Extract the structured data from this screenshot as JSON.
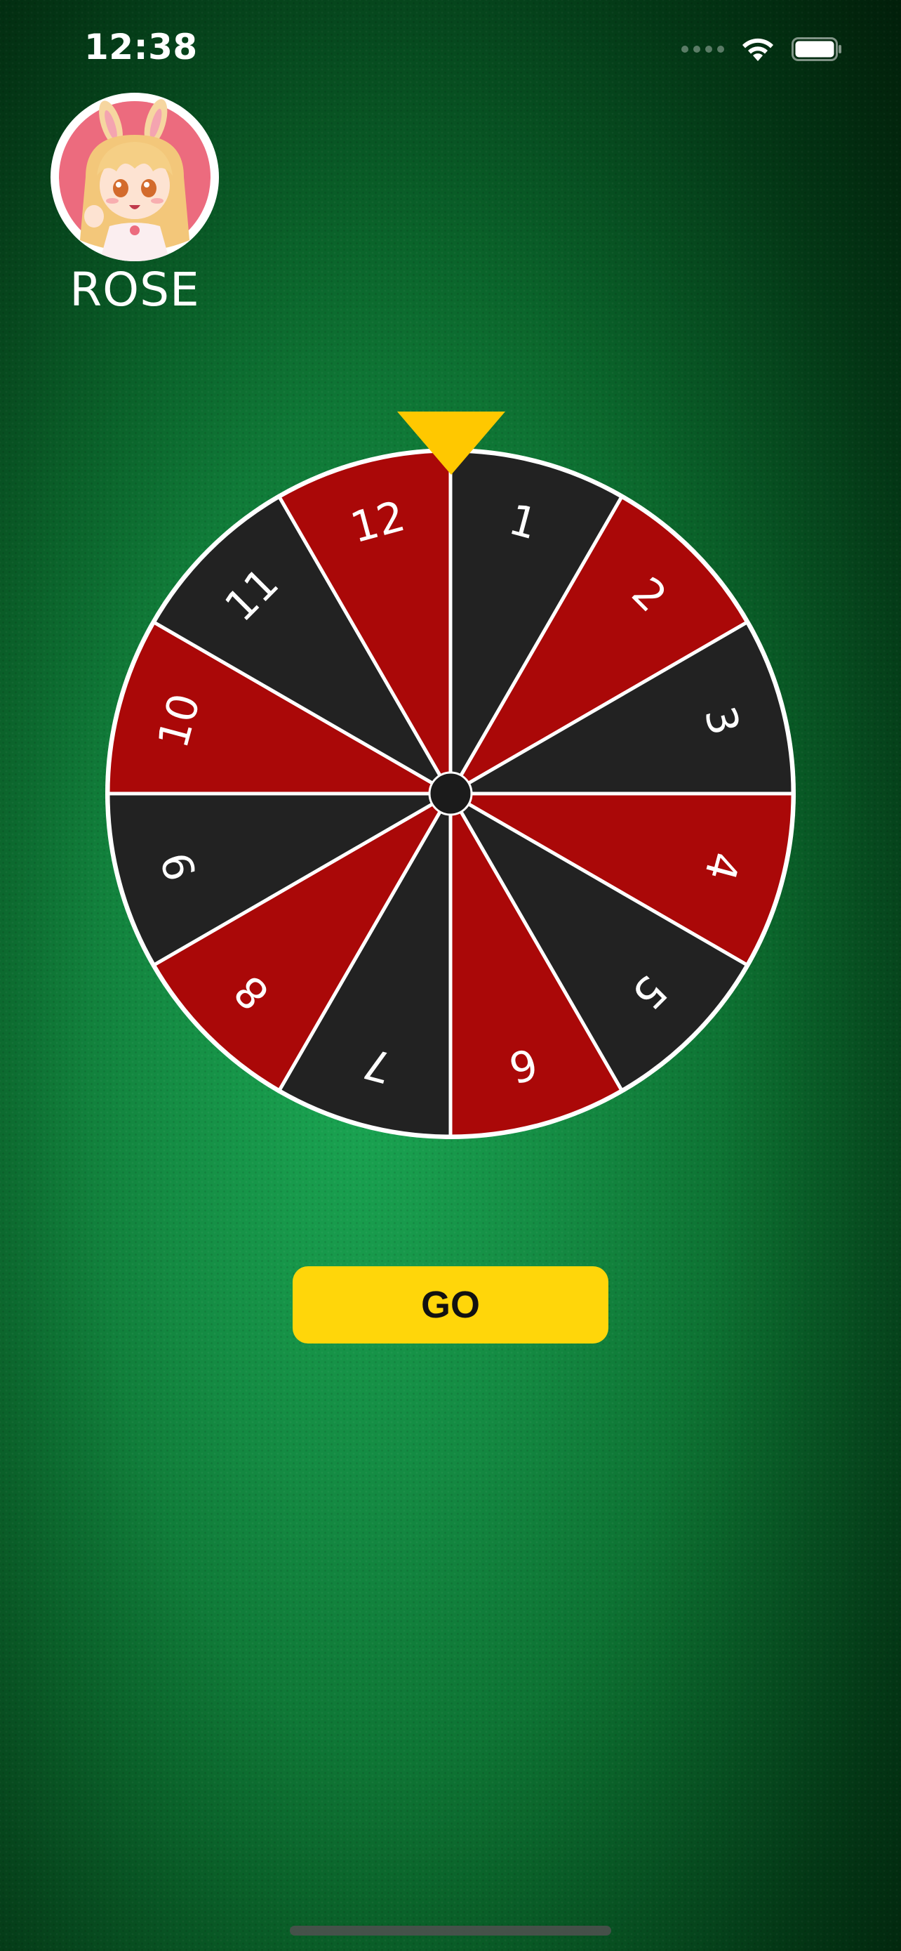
{
  "status_bar": {
    "time": "12:38",
    "icons": [
      "cellular-signal-icon",
      "wifi-icon",
      "battery-icon"
    ]
  },
  "player": {
    "name": "ROSE",
    "avatar_icon": "anime-girl-avatar"
  },
  "wheel": {
    "segments": [
      {
        "label": "1",
        "color": "#222222"
      },
      {
        "label": "2",
        "color": "#aa0808"
      },
      {
        "label": "3",
        "color": "#222222"
      },
      {
        "label": "4",
        "color": "#aa0808"
      },
      {
        "label": "5",
        "color": "#222222"
      },
      {
        "label": "6",
        "color": "#aa0808"
      },
      {
        "label": "7",
        "color": "#222222"
      },
      {
        "label": "8",
        "color": "#aa0808"
      },
      {
        "label": "9",
        "color": "#222222"
      },
      {
        "label": "10",
        "color": "#aa0808"
      },
      {
        "label": "11",
        "color": "#222222"
      },
      {
        "label": "12",
        "color": "#aa0808"
      }
    ],
    "pointer_color": "#ffc800",
    "divider_color": "#ffffff"
  },
  "controls": {
    "go_label": "GO"
  },
  "colors": {
    "felt_green": "#148a42",
    "button_yellow": "#ffd60a"
  }
}
